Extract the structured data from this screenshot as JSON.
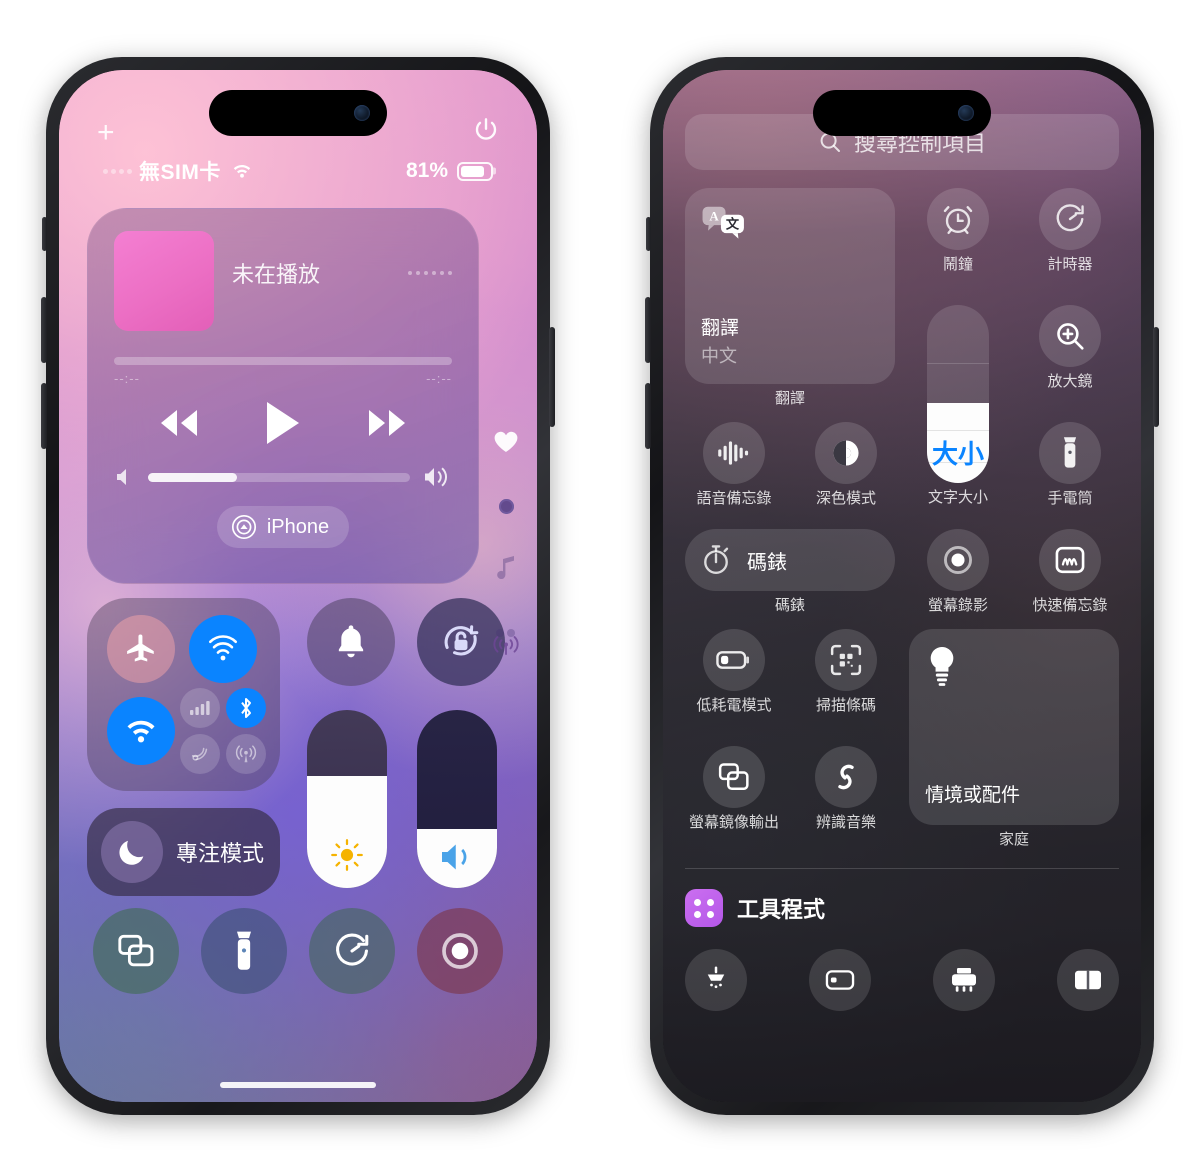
{
  "left_phone": {
    "chrome": {
      "add_label": "+",
      "power_icon": "power-icon"
    },
    "statusbar": {
      "carrier": "無SIM卡",
      "wifi_icon": "wifi-icon",
      "battery_percent": "81%",
      "battery_level": 81
    },
    "media": {
      "title": "未在播放",
      "album_art_color": "#ec6fc4",
      "elapsed": "--:--",
      "remaining": "--:--",
      "scrub_progress": 0,
      "volume_percent": 34,
      "airplay_device": "iPhone",
      "rewind_icon": "rewind-icon",
      "play_icon": "play-icon",
      "forward_icon": "fast-forward-icon",
      "more_icon": "more-dots-icon"
    },
    "page_rail": [
      {
        "name": "favorites-page",
        "icon": "heart-icon"
      },
      {
        "name": "main-page",
        "icon": "dot-icon"
      },
      {
        "name": "music-page",
        "icon": "music-note-icon"
      }
    ],
    "connectivity": {
      "airplane": {
        "label": "飛航模式",
        "icon": "airplane-icon",
        "on": false
      },
      "airdrop": {
        "label": "AirDrop",
        "icon": "airdrop-icon",
        "on": true
      },
      "wifi": {
        "label": "Wi-Fi",
        "icon": "wifi-icon",
        "on": true
      },
      "cellular": {
        "label": "行動數據",
        "icon": "cellular-bars-icon",
        "on": false
      },
      "bluetooth": {
        "label": "藍牙",
        "icon": "bluetooth-icon",
        "on": true
      },
      "satellite": {
        "label": "衛星",
        "icon": "satellite-icon",
        "on": false
      },
      "hotspot": {
        "label": "個人熱點",
        "icon": "personal-hotspot-icon",
        "on": false
      }
    },
    "focus": {
      "label": "專注模式",
      "icon": "moon-icon"
    },
    "toggles": {
      "ring": {
        "label": "鈴聲",
        "icon": "bell-icon"
      },
      "rotation_lock": {
        "label": "方向鎖定",
        "icon": "rotation-lock-icon"
      }
    },
    "sliders": {
      "brightness": {
        "label": "亮度",
        "icon": "sun-icon",
        "value": 63
      },
      "volume": {
        "label": "音量",
        "icon": "speaker-icon",
        "value": 33
      }
    },
    "quick_row": [
      {
        "label": "螢幕鏡像輸出",
        "icon": "screen-mirroring-icon"
      },
      {
        "label": "手電筒",
        "icon": "flashlight-icon"
      },
      {
        "label": "計時器",
        "icon": "timer-icon"
      },
      {
        "label": "螢幕錄影",
        "icon": "screen-record-icon"
      }
    ]
  },
  "right_phone": {
    "search": {
      "placeholder": "搜尋控制項目",
      "icon": "search-icon"
    },
    "controls": {
      "translate": {
        "label": "翻譯",
        "card_title": "翻譯",
        "card_subtitle": "中文",
        "icon": "translate-icon"
      },
      "alarm": {
        "label": "鬧鐘",
        "icon": "alarm-clock-icon"
      },
      "timer": {
        "label": "計時器",
        "icon": "timer-icon"
      },
      "magnifier": {
        "label": "放大鏡",
        "icon": "magnifier-icon"
      },
      "voice_memos": {
        "label": "語音備忘錄",
        "icon": "waveform-icon"
      },
      "dark_mode": {
        "label": "深色模式",
        "icon": "dark-mode-icon"
      },
      "text_size": {
        "label": "文字大小",
        "slider_text": "大小",
        "value": 45,
        "accent": "#0a84ff"
      },
      "flashlight": {
        "label": "手電筒",
        "icon": "flashlight-icon"
      },
      "stopwatch": {
        "label": "碼錶",
        "pill_label": "碼錶",
        "icon": "stopwatch-icon"
      },
      "screen_record": {
        "label": "螢幕錄影",
        "icon": "screen-record-icon"
      },
      "quick_note": {
        "label": "快速備忘錄",
        "icon": "quick-note-icon"
      },
      "low_power": {
        "label": "低耗電模式",
        "icon": "battery-low-icon"
      },
      "scan_code": {
        "label": "掃描條碼",
        "icon": "qr-scan-icon"
      },
      "screen_mirroring": {
        "label": "螢幕鏡像輸出",
        "icon": "screen-mirroring-icon"
      },
      "recognize_music": {
        "label": "辨識音樂",
        "icon": "shazam-icon"
      },
      "home": {
        "label": "家庭",
        "card_title": "情境或配件",
        "icon": "lightbulb-icon"
      }
    },
    "utilities": {
      "title": "工具程式",
      "badge_icon": "grid-dots-icon",
      "badge_color": "#c06fee",
      "peek_items": [
        {
          "icon": "shower-icon"
        },
        {
          "icon": "remote-icon"
        },
        {
          "icon": "printer-icon"
        },
        {
          "icon": "book-icon"
        }
      ]
    }
  }
}
